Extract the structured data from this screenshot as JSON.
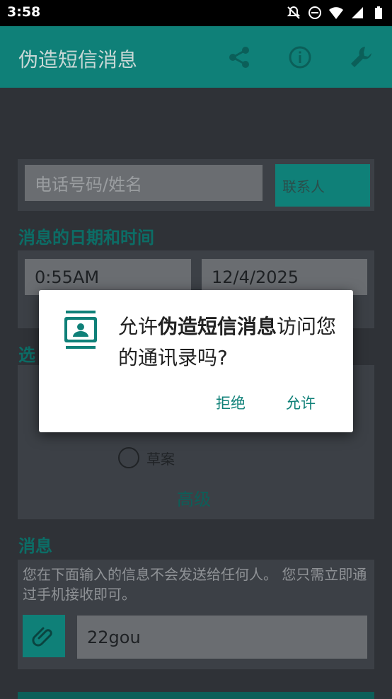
{
  "status_bar": {
    "time": "3:58",
    "icons": [
      "notifications-off-icon",
      "do-not-disturb-icon",
      "wifi-icon",
      "signal-icon",
      "battery-icon"
    ]
  },
  "app_bar": {
    "title": "伪造短信消息",
    "actions": [
      "share-icon",
      "info-icon",
      "wrench-icon"
    ]
  },
  "form": {
    "phone_placeholder": "电话号码/姓名",
    "contacts_button": "联系人",
    "date_time_label": "消息的日期和时间",
    "time_value": "0:55AM",
    "date_value": "12/4/2025",
    "type_label_partial": "选",
    "draft_option": "草案",
    "advanced_label": "高级",
    "message_label": "消息",
    "message_note": "您在下面输入的信息不会发送给任何人。 您只需立即通过手机接收即可。",
    "message_value": "22gou"
  },
  "dialog": {
    "icon": "contacts-icon",
    "message_prefix": "允许",
    "app_name": "伪造短信消息",
    "message_suffix": "访问您的通讯录吗?",
    "deny_label": "拒绝",
    "allow_label": "允许"
  },
  "colors": {
    "accent": "#0f8078",
    "background": "#2f3237",
    "dialog": "#ffffff"
  }
}
